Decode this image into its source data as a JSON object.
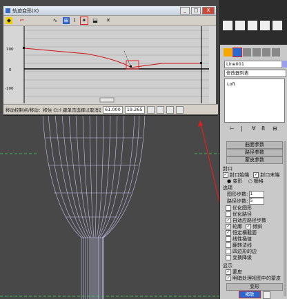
{
  "window": {
    "title": "轨迹变形(X)",
    "min": "_",
    "max": "□",
    "close": "X"
  },
  "toolbar": {
    "icons": [
      "key-icon",
      "line-icon",
      "curve-icon",
      "zoom-icon",
      "insert-point-icon",
      "select-icon",
      "scale-icon",
      "lock-icon",
      "close-icon"
    ]
  },
  "graph": {
    "y_labels": [
      "100",
      "0",
      "-100"
    ]
  },
  "status": {
    "hint": "移动控制点/移动：按住 Ctrl 键单击选择以取消选择",
    "val1": "61.000",
    "val2": "19.265"
  },
  "panel": {
    "object_field": "Line001",
    "modifier_list": "修改器列表",
    "stack_item": "Loft",
    "sections": [
      "曲面参数",
      "路径参数",
      "蒙皮参数"
    ],
    "caps_label": "封口",
    "cap_start": "封口始端",
    "cap_end": "封口末端",
    "morph": "变形",
    "grid": "栅格",
    "options_label": "选项",
    "shape_steps_label": "图形步数:",
    "shape_steps": "1",
    "path_steps_label": "路径步数:",
    "path_steps": "5",
    "opt_optimize_shapes": "优化图形",
    "opt_optimize_path": "优化路径",
    "opt_adaptive": "自适应路径步数",
    "opt_contour": "轮廓",
    "opt_banking": "倾斜",
    "opt_constant_cs": "恒定横截面",
    "opt_linear": "线性插值",
    "opt_flip_normals": "翻转法线",
    "opt_quad_sides": "四边形的边",
    "opt_transform_degrade": "变换降级",
    "display_label": "显示",
    "disp_skin": "蒙皮",
    "disp_skin_shaded": "明暗处理视图中的蒙皮",
    "deform_header": "变形",
    "scale_button": "缩放"
  }
}
